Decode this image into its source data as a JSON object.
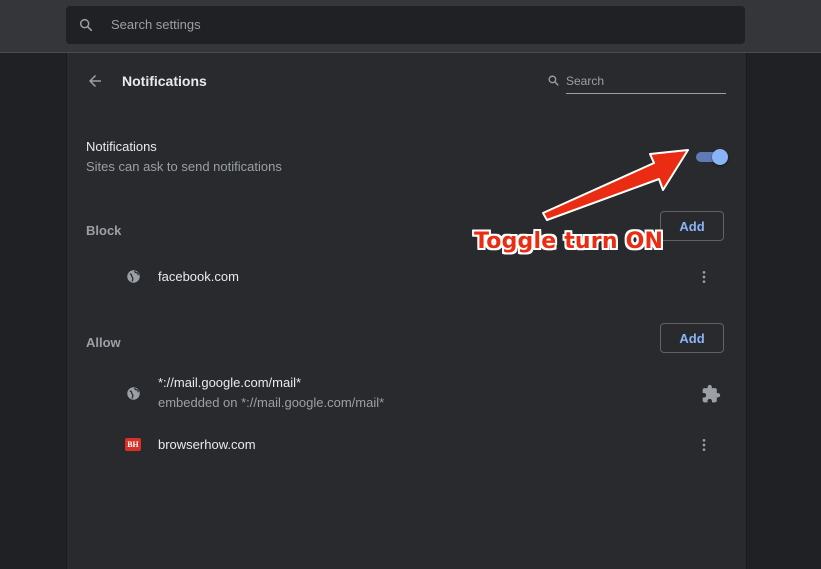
{
  "topbar": {
    "search_placeholder": "Search settings"
  },
  "header": {
    "title": "Notifications",
    "search_placeholder": "Search"
  },
  "notifications": {
    "title": "Notifications",
    "description": "Sites can ask to send notifications",
    "toggle_on": true
  },
  "block": {
    "label": "Block",
    "add_label": "Add",
    "sites": [
      {
        "name": "facebook.com"
      }
    ]
  },
  "allow": {
    "label": "Allow",
    "add_label": "Add",
    "sites": [
      {
        "name": "*://mail.google.com/mail*",
        "sub": "embedded on *://mail.google.com/mail*"
      },
      {
        "name": "browserhow.com",
        "icon_text": "BH"
      }
    ]
  },
  "annotation": {
    "text": "Toggle turn ON",
    "color": "#ea2d12"
  },
  "colors": {
    "accent": "#8ab4f8",
    "background": "#202124",
    "panel": "#292a2d"
  }
}
